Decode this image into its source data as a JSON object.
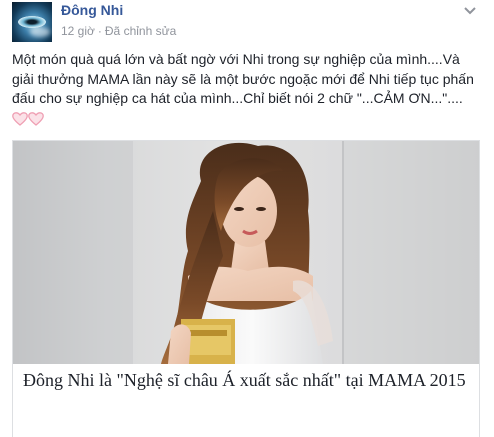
{
  "post": {
    "author": "Đông Nhi",
    "time": "12 giờ",
    "separator": "·",
    "edited": "Đã chỉnh sửa",
    "status_text": "Một món quà quá lớn và bất ngờ với Nhi trong sự nghiệp của mình....Và giải thưởng MAMA lần này sẽ là một bước ngoặc mới để Nhi tiếp tục phấn đấu cho sự nghiệp ca hát của mình...Chỉ biết nói 2 chữ \"...CẢM ƠN...\"....",
    "emoji": [
      "pink-heart-icon",
      "pink-heart-icon"
    ],
    "options_icon": "chevron-down-icon"
  },
  "link_card": {
    "title": "Đông Nhi là \"Nghệ sĩ châu Á xuất sắc nhất\" tại MAMA 2015",
    "image_alt": "woman-in-white-dress-photo"
  },
  "colors": {
    "author": "#365899",
    "meta": "#90949c",
    "text": "#1d2129",
    "border": "#dddfe2",
    "heart": "#f2a0b3"
  }
}
